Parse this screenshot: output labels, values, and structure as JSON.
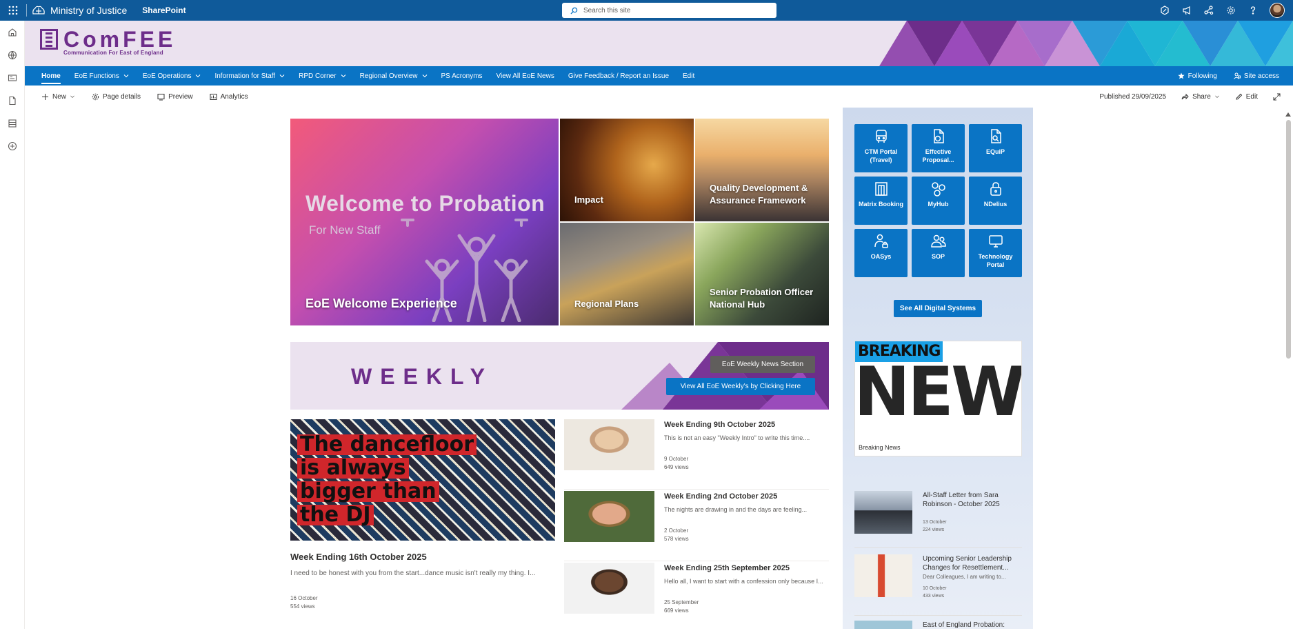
{
  "suite": {
    "org": "Ministry of Justice",
    "app": "SharePoint",
    "search_placeholder": "Search this site"
  },
  "site": {
    "title": "ComFEE",
    "subtitle": "Communication For East of England"
  },
  "nav": {
    "items": [
      {
        "label": "Home",
        "dropdown": false
      },
      {
        "label": "EoE Functions",
        "dropdown": true
      },
      {
        "label": "EoE Operations",
        "dropdown": true
      },
      {
        "label": "Information for Staff",
        "dropdown": true
      },
      {
        "label": "RPD Corner",
        "dropdown": true
      },
      {
        "label": "Regional Overview",
        "dropdown": true
      },
      {
        "label": "PS Acronyms",
        "dropdown": false
      },
      {
        "label": "View All EoE News",
        "dropdown": false
      },
      {
        "label": "Give Feedback / Report an Issue",
        "dropdown": false
      },
      {
        "label": "Edit",
        "dropdown": false
      }
    ],
    "following": "Following",
    "site_access": "Site access"
  },
  "command": {
    "new": "New",
    "page_details": "Page details",
    "preview": "Preview",
    "analytics": "Analytics",
    "published": "Published 29/09/2025",
    "share": "Share",
    "edit": "Edit"
  },
  "hero": {
    "main_overlay_title": "Welcome to Probation",
    "main_overlay_sub": "For New Staff",
    "main_caption": "EoE Welcome Experience",
    "tiles": [
      "Impact",
      "Quality Development & Assurance Framework",
      "Regional Plans",
      "Senior Probation Officer National Hub"
    ]
  },
  "weekly": {
    "title": "WEEKLY",
    "section_button": "EoE Weekly News Section",
    "view_all_button": "View All EoE Weekly's by Clicking Here"
  },
  "feature": {
    "image_text": [
      "The dancefloor",
      "is always",
      "bigger than",
      "the DJ"
    ],
    "title": "Week Ending 16th October 2025",
    "desc": "I need to be honest with you from the start...dance music isn't really my thing. I...",
    "date": "16 October",
    "views": "554 views"
  },
  "news": [
    {
      "title": "Week Ending 9th October 2025",
      "desc": "This is not an easy \"Weekly Intro\" to write this time....",
      "date": "9 October",
      "views": "649 views"
    },
    {
      "title": "Week Ending 2nd October 2025",
      "desc": "The nights are drawing in and the days are feeling...",
      "date": "2 October",
      "views": "578 views"
    },
    {
      "title": "Week Ending 25th September 2025",
      "desc": "Hello all, I want to start with a confession only because I...",
      "date": "25 September",
      "views": "669 views"
    }
  ],
  "quicklinks": [
    {
      "label": "CTM Portal (Travel)",
      "icon": "bus-icon"
    },
    {
      "label": "Effective Proposal...",
      "icon": "document-help-icon"
    },
    {
      "label": "EQuiP",
      "icon": "document-search-icon"
    },
    {
      "label": "Matrix Booking",
      "icon": "building-icon"
    },
    {
      "label": "MyHub",
      "icon": "shapes-icon"
    },
    {
      "label": "NDelius",
      "icon": "lock-icon"
    },
    {
      "label": "OASys",
      "icon": "people-lock-icon"
    },
    {
      "label": "SOP",
      "icon": "people-icon"
    },
    {
      "label": "Technology Portal",
      "icon": "monitor-icon"
    }
  ],
  "see_all": "See All Digital Systems",
  "breaking": {
    "top": "BREAKING",
    "big": "NEWS",
    "label": "Breaking News"
  },
  "side_news": [
    {
      "title": "All-Staff Letter from Sara Robinson - October 2025",
      "desc": "",
      "date": "13 October",
      "views": "224 views"
    },
    {
      "title": "Upcoming Senior Leadership Changes for Resettlement...",
      "desc": "Dear Colleagues, I am writing to...",
      "date": "10 October",
      "views": "433 views"
    },
    {
      "title": "East of England Probation:",
      "desc": "",
      "date": "",
      "views": ""
    }
  ],
  "colors": {
    "suitebar": "#0f5a9a",
    "nav": "#0a74c5",
    "brand_purple": "#6d2d8a",
    "header_bg": "#ebe2ef"
  }
}
